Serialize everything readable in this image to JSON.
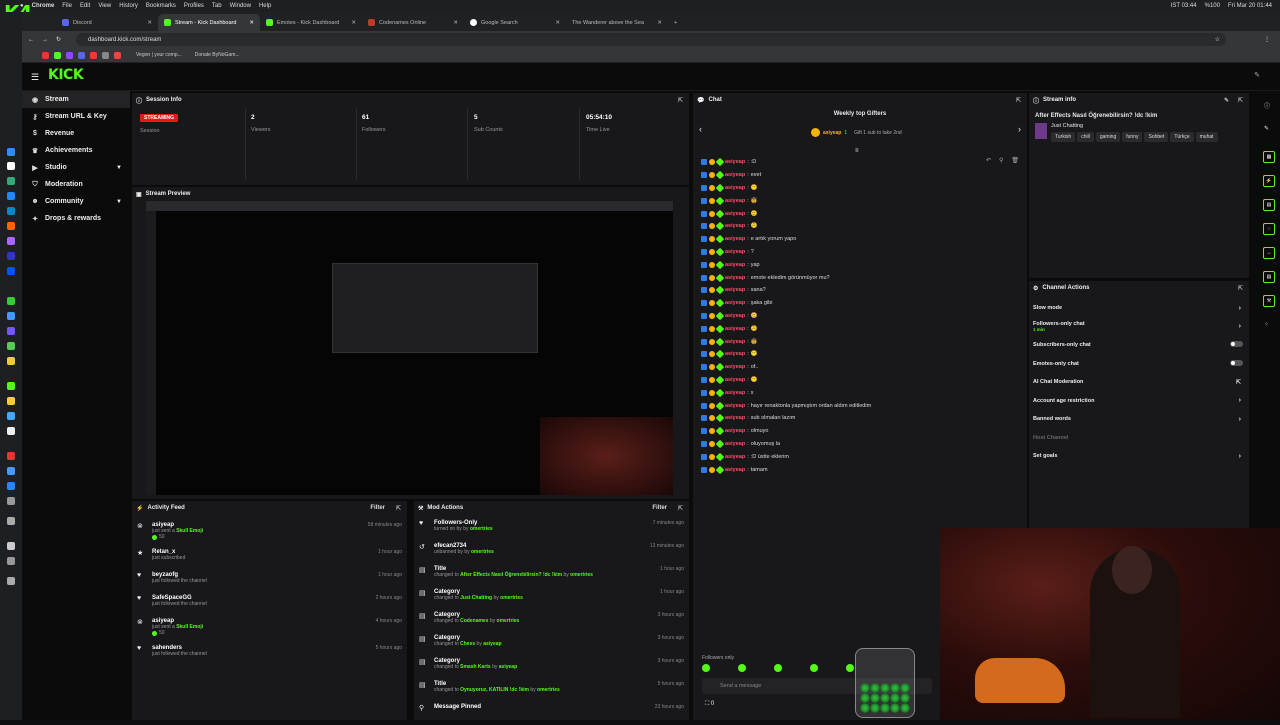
{
  "mac_menu": [
    "Chrome",
    "File",
    "Edit",
    "View",
    "History",
    "Bookmarks",
    "Profiles",
    "Tab",
    "Window",
    "Help"
  ],
  "mac_status": {
    "ime": "IST 03:44",
    "battery": "%100",
    "clock": "Fri Mar 20  01:44"
  },
  "tabs": [
    {
      "label": "Discord",
      "active": false
    },
    {
      "label": "Stream - Kick Dashboard",
      "active": true
    },
    {
      "label": "Emotes - Kick Dashboard",
      "active": false
    },
    {
      "label": "Codenames Online",
      "active": false
    },
    {
      "label": "Google Search",
      "active": false
    },
    {
      "label": "The Wanderer above the Sea",
      "active": false
    }
  ],
  "url": "dashboard.kick.com/stream",
  "bookmarks": [
    "Vegon | your comp...",
    "Donate ByNoGam..."
  ],
  "logo": "KICK",
  "sidebar": [
    {
      "label": "Stream",
      "icon": "broadcast-icon"
    },
    {
      "label": "Stream URL & Key",
      "icon": "key-icon"
    },
    {
      "label": "Revenue",
      "icon": "dollar-icon"
    },
    {
      "label": "Achievements",
      "icon": "trophy-icon"
    },
    {
      "label": "Studio",
      "icon": "video-icon",
      "chevron": true
    },
    {
      "label": "Moderation",
      "icon": "shield-icon"
    },
    {
      "label": "Community",
      "icon": "users-icon",
      "chevron": true
    },
    {
      "label": "Drops & rewards",
      "icon": "gift-icon"
    }
  ],
  "session": {
    "title": "Session Info",
    "status": "STREAMING",
    "stats": [
      {
        "value": "STREAMING",
        "label": "Session"
      },
      {
        "value": "2",
        "label": "Viewers"
      },
      {
        "value": "61",
        "label": "Followers"
      },
      {
        "value": "5",
        "label": "Sub Counts"
      },
      {
        "value": "05:54:10",
        "label": "Time Live"
      }
    ]
  },
  "preview_title": "Stream Preview",
  "activity": {
    "title": "Activity Feed",
    "filter": "Filter",
    "items": [
      {
        "name": "asiyeap",
        "sub": "just sent a",
        "hl": "Skull Emoji",
        "extra": "50",
        "time": "58 minutes ago",
        "icon": "x-circle-icon"
      },
      {
        "name": "Retan_x",
        "sub": "just subscribed",
        "hl": "",
        "extra": "",
        "time": "1 hour ago",
        "icon": "star-icon"
      },
      {
        "name": "beyzaofg",
        "sub": "just followed the channel",
        "hl": "",
        "extra": "",
        "time": "1 hour ago",
        "icon": "heart-icon"
      },
      {
        "name": "SafeSpaceGG",
        "sub": "just followed the channel",
        "hl": "",
        "extra": "",
        "time": "2 hours ago",
        "icon": "heart-icon"
      },
      {
        "name": "asiyeap",
        "sub": "just sent a",
        "hl": "Skull Emoji",
        "extra": "50",
        "time": "4 hours ago",
        "icon": "x-circle-icon"
      },
      {
        "name": "sahenders",
        "sub": "just followed the channel",
        "hl": "",
        "extra": "",
        "time": "5 hours ago",
        "icon": "heart-icon"
      }
    ]
  },
  "mod": {
    "title": "Mod Actions",
    "filter": "Filter",
    "items": [
      {
        "name": "Followers-Only",
        "pre": "turned on by",
        "hl": "",
        "by": "omertries",
        "time": "7 minutes ago",
        "icon": "heart-icon"
      },
      {
        "name": "efecan2734",
        "pre": "unbanned by",
        "hl": "",
        "by": "omertries",
        "time": "13 minutes ago",
        "icon": "undo-icon"
      },
      {
        "name": "Title",
        "pre": "changed to",
        "hl": "After Effects Nasıl Öğrenebilirsin? !dc !kim",
        "by": "omertries",
        "time": "1 hour ago",
        "icon": "doc-icon"
      },
      {
        "name": "Category",
        "pre": "changed to",
        "hl": "Just Chatting",
        "by": "omertries",
        "time": "1 hour ago",
        "icon": "doc-icon"
      },
      {
        "name": "Category",
        "pre": "changed to",
        "hl": "Codenames",
        "by": "omertries",
        "time": "3 hours ago",
        "icon": "doc-icon"
      },
      {
        "name": "Category",
        "pre": "changed to",
        "hl": "Chess",
        "by": "asiyeap",
        "time": "3 hours ago",
        "icon": "doc-icon"
      },
      {
        "name": "Category",
        "pre": "changed to",
        "hl": "Smash Karts",
        "by": "asiyeap",
        "time": "3 hours ago",
        "icon": "doc-icon"
      },
      {
        "name": "Title",
        "pre": "changed to",
        "hl": "Oynuyoruz, KATILIN !dc !kim",
        "by": "omertries",
        "time": "5 hours ago",
        "icon": "doc-icon"
      },
      {
        "name": "Message Pinned",
        "pre": "",
        "hl": "",
        "by": "",
        "time": "23 hours ago",
        "icon": "pin-icon"
      }
    ]
  },
  "chat": {
    "title": "Chat",
    "gifters_title": "Weekly top Gifters",
    "gifter_name": "asiyeap",
    "gifter_count": "1",
    "gifter_note": "Gift 1 sub to take 2nd",
    "username": "asiyeap",
    "messages": [
      ":D",
      "evet",
      "😶",
      "🤠",
      "🙂",
      "🙃",
      "e artık yorum yapo",
      "?",
      "yap",
      "emote ekledim görünmüyor mu?",
      "sana?",
      "şaka gibi",
      "🙂",
      "🙃",
      "🤠",
      "😶",
      "of..",
      "😶",
      "x",
      "hayır renaktonla yapmıştım ordan aldım editledim",
      "sub olmaları lazım",
      "olmuyo",
      "oluyomuş la",
      ":D üstte eklerim",
      "tamam"
    ],
    "followers_only": "Followers only",
    "placeholder": "Send a message",
    "count": "0"
  },
  "stream_info": {
    "title": "Stream info",
    "stream_title": "After Effects Nasıl Öğrenebilirsin? !dc !kim",
    "category": "Just Chatting",
    "tags": [
      "Turkish",
      "chill",
      "gaming",
      "funny",
      "Sohbet",
      "Türkçe",
      "muhat"
    ]
  },
  "channel_actions": {
    "title": "Channel Actions",
    "items": [
      {
        "label": "Slow mode",
        "ctrl": "chevron"
      },
      {
        "label": "Followers-only chat",
        "ctrl": "chevron",
        "note": "1 min"
      },
      {
        "label": "Subscribers-only chat",
        "ctrl": "toggle"
      },
      {
        "label": "Emotes-only chat",
        "ctrl": "toggle"
      },
      {
        "label": "AI Chat Moderation",
        "ctrl": "ext"
      },
      {
        "label": "Account age restriction",
        "ctrl": "chevron"
      },
      {
        "label": "Banned words",
        "ctrl": "chevron"
      },
      {
        "label": "Host Channel",
        "ctrl": "none",
        "dim": true
      },
      {
        "label": "Set goals",
        "ctrl": "chevron"
      }
    ]
  },
  "colors": {
    "accent": "#53fc18",
    "live": "#e91916",
    "panel": "#18181b",
    "name": "#ff4e6a"
  }
}
